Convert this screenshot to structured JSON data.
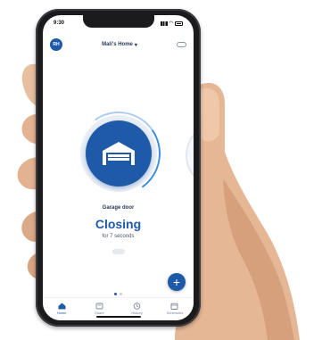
{
  "status_bar": {
    "time": "9:30"
  },
  "header": {
    "avatar_initials": "RH",
    "home_name": "Mali's Home",
    "home_chevron": "▾"
  },
  "device": {
    "name": "Garage door",
    "status": "Closing",
    "substatus": "for 7 seconds",
    "icon": "garage-door-icon"
  },
  "fab": {
    "label": "+"
  },
  "carousel": {
    "pages": 2,
    "active_page": 1
  },
  "tabs": [
    {
      "label": "Home",
      "icon": "home-icon",
      "active": true
    },
    {
      "label": "Share",
      "icon": "share-icon",
      "active": false
    },
    {
      "label": "History",
      "icon": "history-icon",
      "active": false
    },
    {
      "label": "Schedules",
      "icon": "calendar-icon",
      "active": false
    }
  ],
  "colors": {
    "brand": "#1e5aa7",
    "ring_accent": "#3f8fe0"
  }
}
